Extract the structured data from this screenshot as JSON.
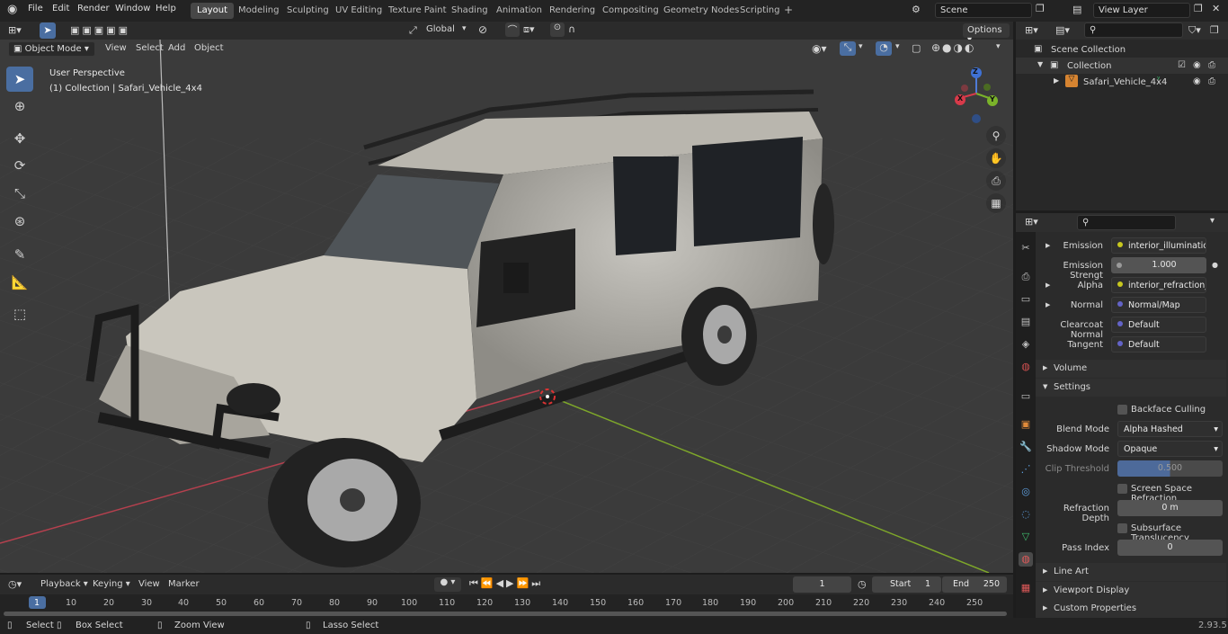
{
  "topbar": {
    "menus": [
      "File",
      "Edit",
      "Render",
      "Window",
      "Help"
    ],
    "workspaces": [
      "Layout",
      "Modeling",
      "Sculpting",
      "UV Editing",
      "Texture Paint",
      "Shading",
      "Animation",
      "Rendering",
      "Compositing",
      "Geometry Nodes",
      "Scripting"
    ],
    "active_workspace": "Layout",
    "add_tab": "+",
    "scene": "Scene",
    "view_layer": "View Layer"
  },
  "viewport_header": {
    "mode": "Object Mode",
    "menus": [
      "View",
      "Select",
      "Add",
      "Object"
    ],
    "orientation": "Global",
    "options": "Options"
  },
  "viewport": {
    "overlay_line1": "User Perspective",
    "overlay_line2": "(1) Collection | Safari_Vehicle_4x4",
    "gizmo": {
      "z": "Z",
      "y": "Y",
      "x": "X"
    }
  },
  "outliner": {
    "root": "Scene Collection",
    "collection": "Collection",
    "object": "Safari_Vehicle_4x4"
  },
  "properties": {
    "rows": [
      {
        "label": "Emission",
        "value": "interior_illumination...",
        "color": "#c8c81e"
      },
      {
        "label": "Emission Strengt",
        "value": "1.000",
        "color": "#9a9a9a"
      },
      {
        "label": "Alpha",
        "value": "interior_refraction_in...",
        "color": "#c8c81e"
      },
      {
        "label": "Normal",
        "value": "Normal/Map",
        "color": "#6363c7"
      },
      {
        "label": "Clearcoat Normal",
        "value": "Default",
        "color": "#6363c7"
      },
      {
        "label": "Tangent",
        "value": "Default",
        "color": "#6363c7"
      }
    ],
    "sections": {
      "volume": "Volume",
      "settings": "Settings",
      "line_art": "Line Art",
      "viewport_display": "Viewport Display",
      "custom_props": "Custom Properties"
    },
    "backface_culling": "Backface Culling",
    "blend_mode_label": "Blend Mode",
    "blend_mode": "Alpha Hashed",
    "shadow_mode_label": "Shadow Mode",
    "shadow_mode": "Opaque",
    "clip_threshold_label": "Clip Threshold",
    "clip_threshold": "0.500",
    "ssr": "Screen Space Refraction",
    "refraction_depth_label": "Refraction Depth",
    "refraction_depth": "0 m",
    "subsurface": "Subsurface Translucency",
    "pass_index_label": "Pass Index",
    "pass_index": "0"
  },
  "timeline": {
    "menus": [
      "Playback",
      "Keying",
      "View",
      "Marker"
    ],
    "current_frame": "1",
    "start_label": "Start",
    "start": "1",
    "end_label": "End",
    "end": "250",
    "ticks": [
      "1",
      "10",
      "20",
      "30",
      "40",
      "50",
      "60",
      "70",
      "80",
      "90",
      "100",
      "110",
      "120",
      "130",
      "140",
      "150",
      "160",
      "170",
      "180",
      "190",
      "200",
      "210",
      "220",
      "230",
      "240",
      "250"
    ]
  },
  "statusbar": {
    "select": "Select",
    "box_select": "Box Select",
    "zoom_view": "Zoom View",
    "lasso_select": "Lasso Select",
    "version": "2.93.5"
  }
}
